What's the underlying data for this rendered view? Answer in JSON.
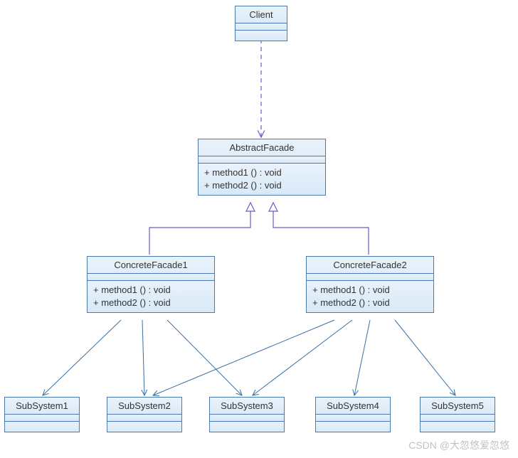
{
  "classes": {
    "client": {
      "name": "Client"
    },
    "abstractFacade": {
      "name": "AbstractFacade",
      "methods": [
        "+  method1 () : void",
        "+  method2 () : void"
      ]
    },
    "concreteFacade1": {
      "name": "ConcreteFacade1",
      "methods": [
        "+  method1 () : void",
        "+  method2 () : void"
      ]
    },
    "concreteFacade2": {
      "name": "ConcreteFacade2",
      "methods": [
        "+  method1 () : void",
        "+  method2 () : void"
      ]
    },
    "sub1": {
      "name": "SubSystem1"
    },
    "sub2": {
      "name": "SubSystem2"
    },
    "sub3": {
      "name": "SubSystem3"
    },
    "sub4": {
      "name": "SubSystem4"
    },
    "sub5": {
      "name": "SubSystem5"
    }
  },
  "watermark": "CSDN @大忽悠爱忽悠"
}
